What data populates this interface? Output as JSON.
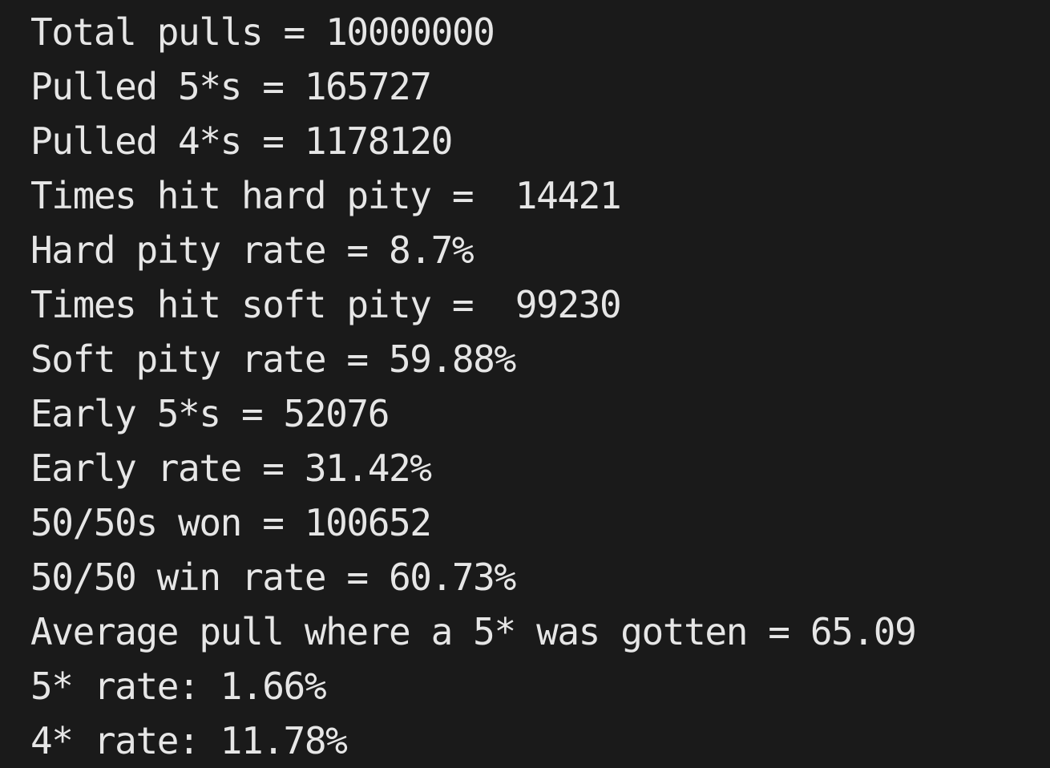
{
  "terminal": {
    "lines": [
      "Total pulls = 10000000",
      "Pulled 5*s = 165727",
      "Pulled 4*s = 1178120",
      "Times hit hard pity =  14421",
      "Hard pity rate = 8.7%",
      "Times hit soft pity =  99230",
      "Soft pity rate = 59.88%",
      "Early 5*s = 52076",
      "Early rate = 31.42%",
      "50/50s won = 100652",
      "50/50 win rate = 60.73%",
      "Average pull where a 5* was gotten = 65.09",
      "5* rate: 1.66%",
      "4* rate: 11.78%"
    ]
  },
  "colors": {
    "background": "#1a1a1a",
    "text": "#e6e6e6"
  }
}
